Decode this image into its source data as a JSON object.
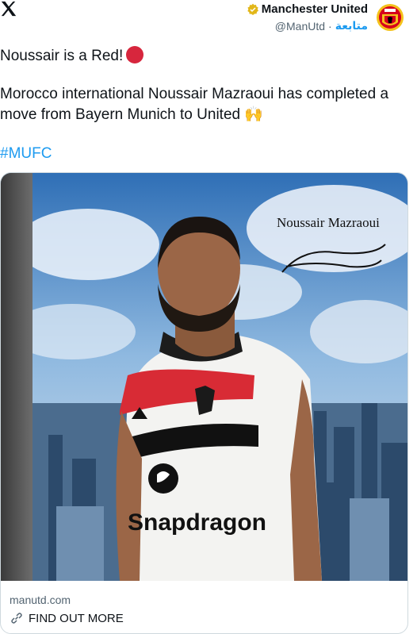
{
  "header": {
    "account_name": "Manchester United",
    "handle": "@ManUtd",
    "separator": "·",
    "follow_label": "متابعة"
  },
  "tweet": {
    "line1": "Noussair is a Red!",
    "line2": "Morocco international Noussair Mazraoui has completed a move from Bayern Munich to United 🙌",
    "hashtag": "#MUFC"
  },
  "card": {
    "signature_name": "Noussair Mazraoui",
    "domain": "manutd.com",
    "cta": "FIND OUT MORE",
    "shirt_sponsor": "Snapdragon"
  },
  "colors": {
    "link_blue": "#1d9bf0",
    "red": "#d7263d",
    "verified_gold": "#e2b719"
  },
  "icons": [
    "x-logo-icon",
    "verified-badge-icon",
    "club-crest-icon",
    "red-circle-emoji",
    "raising-hands-emoji",
    "link-icon"
  ]
}
